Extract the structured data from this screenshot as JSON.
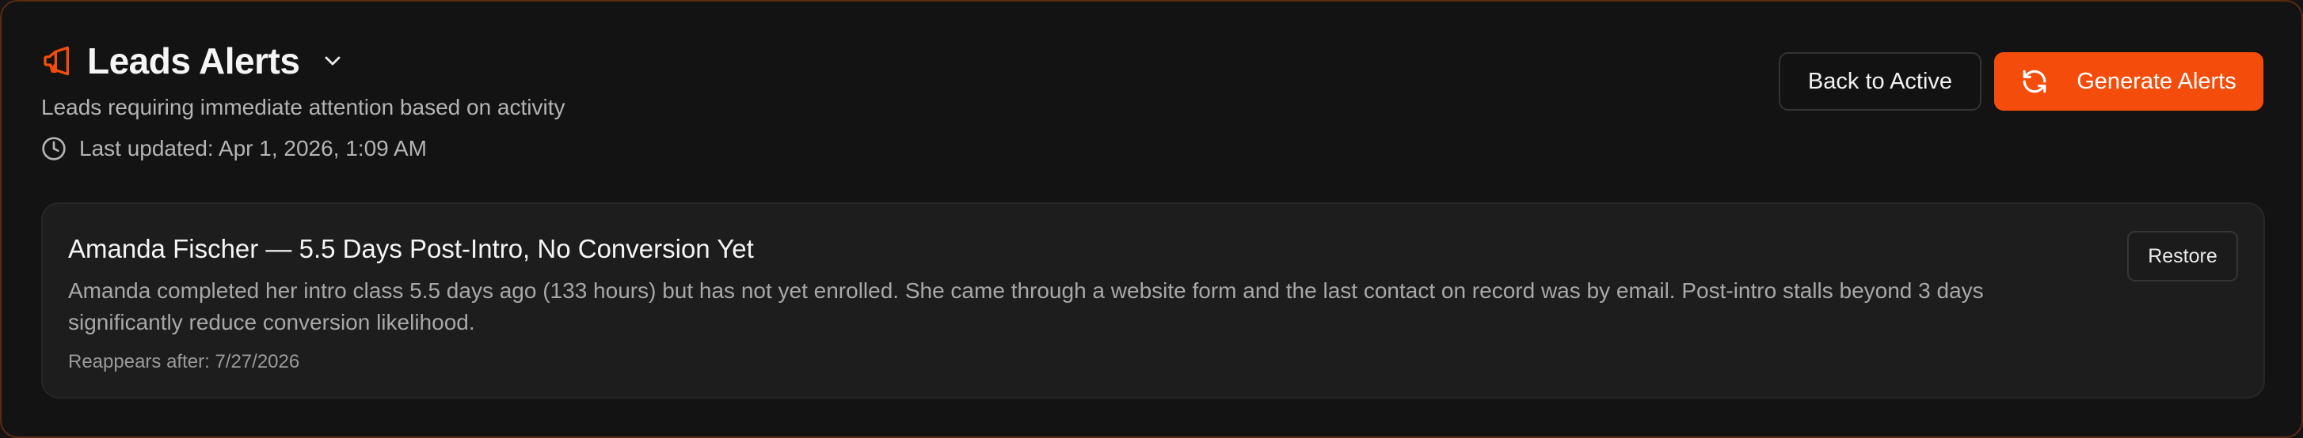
{
  "header": {
    "title": "Leads Alerts",
    "title_icon": "megaphone-icon",
    "subtitle": "Leads requiring immediate attention based on activity",
    "last_updated": "Last updated: Apr 1, 2026, 1:09 AM"
  },
  "actions": {
    "back_label": "Back to Active",
    "generate_label": "Generate Alerts"
  },
  "alerts": [
    {
      "title": "Amanda Fischer — 5.5 Days Post-Intro, No Conversion Yet",
      "body": "Amanda completed her intro class 5.5 days ago (133 hours) but has not yet enrolled. She came through a website form and the last contact on record was by email. Post-intro stalls beyond 3 days significantly reduce conversion likelihood.",
      "reappears": "Reappears after: 7/27/2026",
      "restore_label": "Restore"
    }
  ],
  "colors": {
    "accent": "#f44d0b",
    "background": "#131313",
    "card": "#1d1d1d",
    "border_accent": "#5a2a14"
  }
}
